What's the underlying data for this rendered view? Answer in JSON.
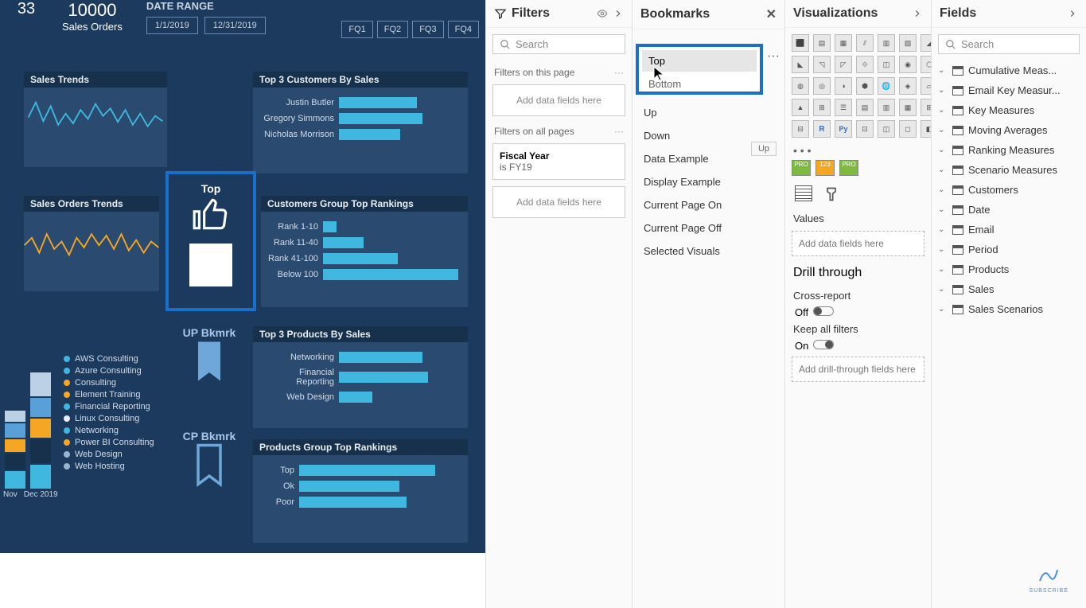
{
  "report": {
    "kpi1_value": "33",
    "kpi2_value": "10000",
    "kpi2_label": "Sales Orders",
    "date_range_label": "DATE RANGE",
    "date_start": "1/1/2019",
    "date_end": "12/31/2019",
    "fq_buttons": [
      "FQ1",
      "FQ2",
      "FQ3",
      "FQ4"
    ],
    "cards": {
      "sales_trends": {
        "title": "Sales Trends"
      },
      "top_customers": {
        "title": "Top 3 Customers By Sales",
        "rows": [
          {
            "label": "Justin Butler",
            "pct": 70
          },
          {
            "label": "Gregory Simmons",
            "pct": 75
          },
          {
            "label": "Nicholas Morrison",
            "pct": 55
          }
        ]
      },
      "sales_orders_trends": {
        "title": "Sales Orders Trends"
      },
      "customer_rankings": {
        "title": "Customers Group Top Rankings",
        "rows": [
          {
            "label": "Rank 1-10",
            "pct": 10
          },
          {
            "label": "Rank 11-40",
            "pct": 30
          },
          {
            "label": "Rank 41-100",
            "pct": 55
          },
          {
            "label": "Below 100",
            "pct": 100
          }
        ]
      },
      "top_products": {
        "title": "Top 3 Products By Sales",
        "rows": [
          {
            "label": "Networking",
            "pct": 75
          },
          {
            "label": "Financial Reporting",
            "pct": 80
          },
          {
            "label": "Web Design",
            "pct": 30
          }
        ]
      },
      "product_rankings": {
        "title": "Products Group Top Rankings",
        "rows": [
          {
            "label": "Top",
            "pct": 95
          },
          {
            "label": "Ok",
            "pct": 70
          },
          {
            "label": "Poor",
            "pct": 75
          }
        ]
      },
      "months": {
        "m1": "Nov",
        "m2": "Dec 2019"
      },
      "legend": [
        "AWS Consulting",
        "Azure Consulting",
        "Consulting",
        "Element Training",
        "Financial Reporting",
        "Linux Consulting",
        "Networking",
        "Power BI Consulting",
        "Web Design",
        "Web Hosting"
      ],
      "top_button": "Top",
      "up_bkmrk": "UP Bkmrk",
      "cp_bkmrk": "CP Bkmrk"
    }
  },
  "filters": {
    "title": "Filters",
    "search_placeholder": "Search",
    "on_page": "Filters on this page",
    "on_all": "Filters on all pages",
    "add_fields": "Add data fields here",
    "fiscal_year_label": "Fiscal Year",
    "fiscal_year_value": "is FY19"
  },
  "bookmarks": {
    "title": "Bookmarks",
    "top_item": "Top",
    "top_sub": "Bottom",
    "items": [
      "Up",
      "Down",
      "Data Example",
      "Display Example",
      "Current Page On",
      "Current Page Off",
      "Selected Visuals"
    ],
    "tooltip": "Up"
  },
  "viz": {
    "title": "Visualizations",
    "values_label": "Values",
    "add_fields": "Add data fields here",
    "drill_label": "Drill through",
    "cross_report": "Cross-report",
    "off": "Off",
    "keep_filters": "Keep all filters",
    "on": "On",
    "drill_fields": "Add drill-through fields here",
    "more": "• • •"
  },
  "fields": {
    "title": "Fields",
    "search_placeholder": "Search",
    "tables": [
      "Cumulative Meas...",
      "Email Key Measur...",
      "Key Measures",
      "Moving Averages",
      "Ranking Measures",
      "Scenario Measures",
      "Customers",
      "Date",
      "Email",
      "Period",
      "Products",
      "Sales",
      "Sales Scenarios"
    ]
  },
  "chart_data": [
    {
      "type": "line",
      "title": "Sales Trends",
      "series": [
        {
          "name": "Sales",
          "color": "#3fb7de"
        }
      ],
      "note": "sparkline, unlabeled axes"
    },
    {
      "type": "bar",
      "title": "Top 3 Customers By Sales",
      "categories": [
        "Justin Butler",
        "Gregory Simmons",
        "Nicholas Morrison"
      ],
      "values": [
        70,
        75,
        55
      ],
      "orientation": "horizontal"
    },
    {
      "type": "line",
      "title": "Sales Orders Trends",
      "series": [
        {
          "name": "Orders",
          "color": "#f5a623"
        }
      ],
      "note": "sparkline, unlabeled axes"
    },
    {
      "type": "bar",
      "title": "Customers Group Top Rankings",
      "categories": [
        "Rank 1-10",
        "Rank 11-40",
        "Rank 41-100",
        "Below 100"
      ],
      "values": [
        10,
        30,
        55,
        100
      ],
      "orientation": "horizontal"
    },
    {
      "type": "bar",
      "title": "Top 3 Products By Sales",
      "categories": [
        "Networking",
        "Financial Reporting",
        "Web Design"
      ],
      "values": [
        75,
        80,
        30
      ],
      "orientation": "horizontal"
    },
    {
      "type": "bar",
      "title": "Products Group Top Rankings",
      "categories": [
        "Top",
        "Ok",
        "Poor"
      ],
      "values": [
        95,
        70,
        75
      ],
      "orientation": "horizontal"
    },
    {
      "type": "bar",
      "title": "Stacked column (legend visible)",
      "legend": [
        "AWS Consulting",
        "Azure Consulting",
        "Consulting",
        "Element Training",
        "Financial Reporting",
        "Linux Consulting",
        "Networking",
        "Power BI Consulting",
        "Web Design",
        "Web Hosting"
      ],
      "x_visible": [
        "Nov",
        "Dec 2019"
      ]
    }
  ]
}
